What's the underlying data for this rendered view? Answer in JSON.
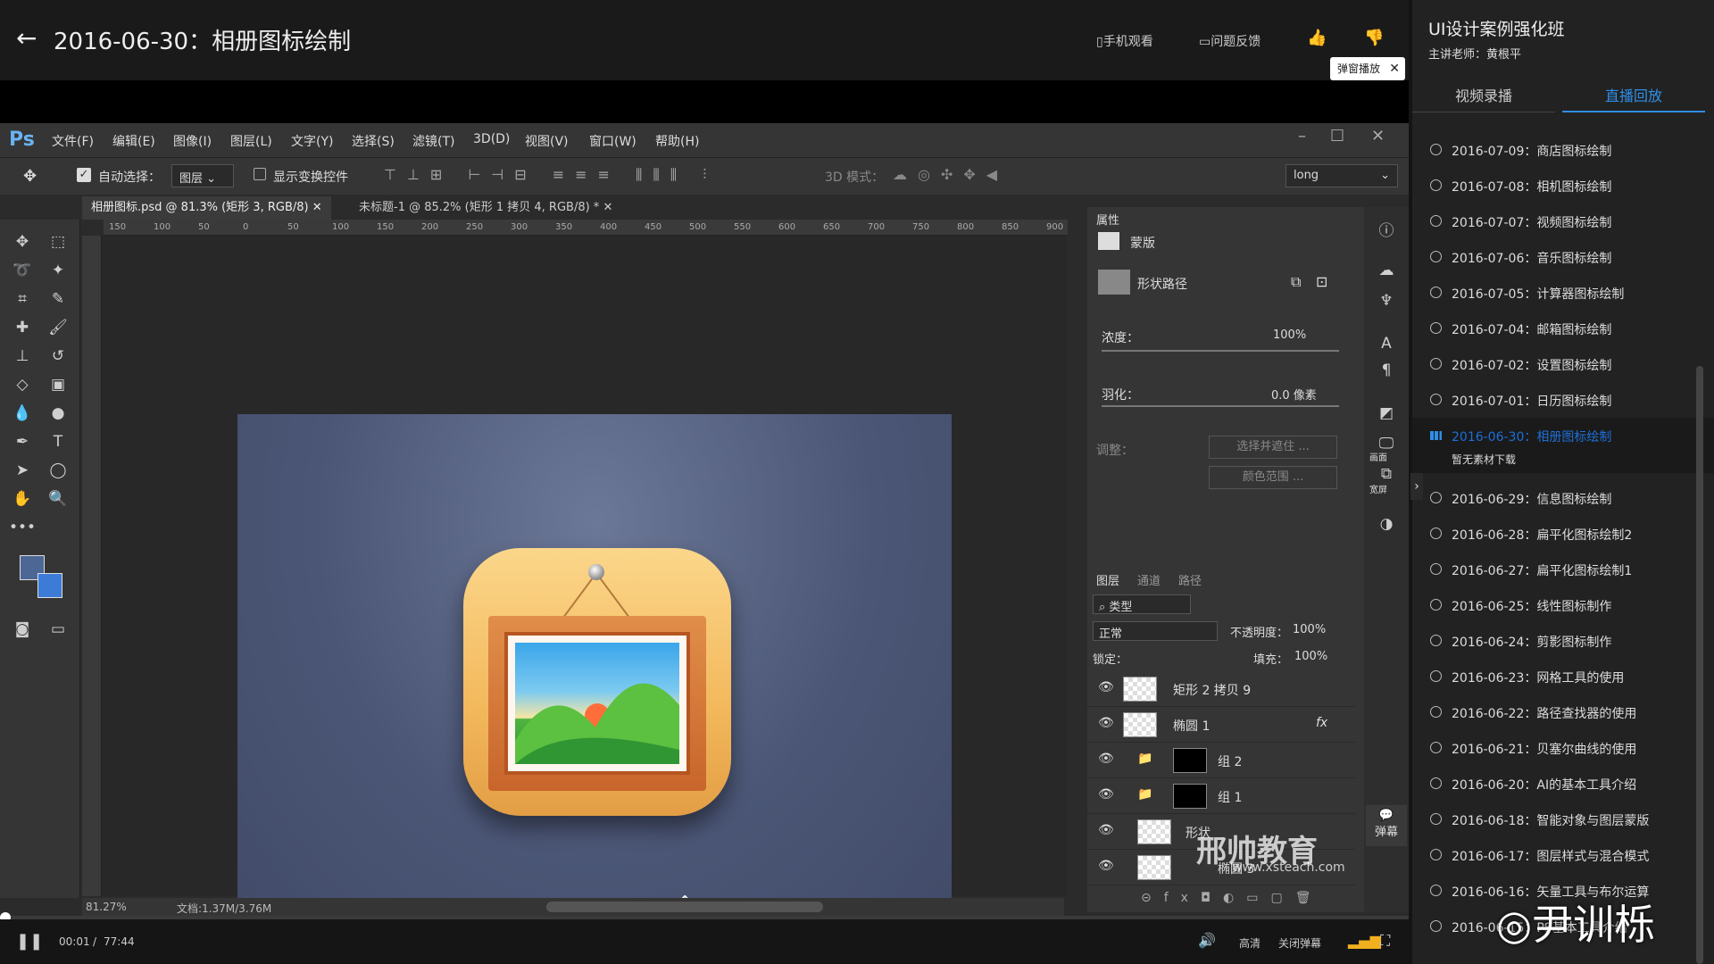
{
  "header": {
    "title": "2016-06-30：相册图标绘制",
    "mobile_watch": "手机观看",
    "feedback": "问题反馈",
    "danmu_tip": "弹窗播放"
  },
  "ps": {
    "logo": "Ps",
    "menu": [
      "文件(F)",
      "编辑(E)",
      "图像(I)",
      "图层(L)",
      "文字(Y)",
      "选择(S)",
      "滤镜(T)",
      "3D(D)",
      "视图(V)",
      "窗口(W)",
      "帮助(H)"
    ],
    "options": {
      "auto_select": "自动选择：",
      "auto_select_value": "图层",
      "show_transform": "显示变换控件",
      "mode3d": "3D 模式：",
      "workspace": "long"
    },
    "tabs": [
      "相册图标.psd @ 81.3% (矩形 3, RGB/8)",
      "未标题-1 @ 85.2% (矩形 1 拷贝 4, RGB/8) *"
    ],
    "ruler_labels": [
      "150",
      "100",
      "50",
      "0",
      "50",
      "100",
      "150",
      "200",
      "250",
      "300",
      "350",
      "400",
      "450",
      "500",
      "550",
      "600",
      "650",
      "700",
      "750",
      "800",
      "850",
      "900"
    ],
    "status": {
      "zoom": "81.27%",
      "doc": "文档:1.37M/3.76M"
    }
  },
  "properties": {
    "tab": "属性",
    "mask_label": "蒙版",
    "shape_path": "形状路径",
    "density_label": "浓度：",
    "density_value": "100%",
    "feather_label": "羽化：",
    "feather_value": "0.0 像素",
    "adjust_label": "调整：",
    "select_mask": "选择并遮住 ...",
    "color_range": "颜色范围 ..."
  },
  "layers": {
    "tabs": [
      "图层",
      "通道",
      "路径"
    ],
    "filter": "类型",
    "blend": "正常",
    "opacity_label": "不透明度：",
    "opacity_value": "100%",
    "lock_label": "锁定：",
    "fill_label": "填充：",
    "fill_value": "100%",
    "items": [
      {
        "name": "矩形 2 拷贝 9"
      },
      {
        "name": "椭圆 1",
        "fx": "fx"
      },
      {
        "name": "组 2"
      },
      {
        "name": "组 1"
      },
      {
        "name": "形状"
      },
      {
        "name": "椭圆 3"
      }
    ]
  },
  "iconbar": {
    "danmu": "弹幕",
    "screen1": "画面",
    "screen2": "宽屏"
  },
  "player": {
    "current": "00:01",
    "separator": "/",
    "total": "77:44",
    "quality": "高清",
    "close_danmu": "关闭弹幕",
    "progress": 0.0002
  },
  "sidebar": {
    "course_title": "UI设计案例强化班",
    "teacher": "主讲老师：黄根平",
    "tabs": [
      "视频录播",
      "直播回放"
    ],
    "no_material": "暂无素材下载",
    "lessons": [
      "2016-07-09：商店图标绘制",
      "2016-07-08：相机图标绘制",
      "2016-07-07：视频图标绘制",
      "2016-07-06：音乐图标绘制",
      "2016-07-05：计算器图标绘制",
      "2016-07-04：邮箱图标绘制",
      "2016-07-02：设置图标绘制",
      "2016-07-01：日历图标绘制",
      "2016-06-30：相册图标绘制",
      "2016-06-29：信息图标绘制",
      "2016-06-28：扁平化图标绘制2",
      "2016-06-27：扁平化图标绘制1",
      "2016-06-25：线性图标制作",
      "2016-06-24：剪影图标制作",
      "2016-06-23：网格工具的使用",
      "2016-06-22：路径查找器的使用",
      "2016-06-21：贝塞尔曲线的使用",
      "2016-06-20：AI的基本工具介绍",
      "2016-06-18：智能对象与图层蒙版",
      "2016-06-17：图层样式与混合模式",
      "2016-06-16：矢量工具与布尔运算",
      "2016-06-15：PS基本工具介绍"
    ]
  },
  "watermarks": {
    "site_cn": "邢帅教育",
    "site_url": "www.xsteach.com",
    "weibo": "尹训栎"
  },
  "colors": {
    "accent": "#2f8fe8",
    "active_lesson": "#1e6fd9"
  }
}
